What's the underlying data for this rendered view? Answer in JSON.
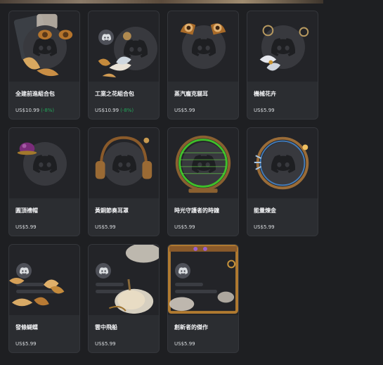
{
  "colors": {
    "background": "#1e1f22",
    "card": "#2b2d31",
    "discount": "#23a55a"
  },
  "items": [
    {
      "name": "全建前進組合包",
      "price": "US$10.99",
      "discount": "(-8%)"
    },
    {
      "name": "工業之花組合包",
      "price": "US$10.99",
      "discount": "(-8%)"
    },
    {
      "name": "蒸汽龐克貓耳",
      "price": "US$5.99",
      "discount": ""
    },
    {
      "name": "機械花卉",
      "price": "US$5.99",
      "discount": ""
    },
    {
      "name": "圓頂禮帽",
      "price": "US$5.99",
      "discount": ""
    },
    {
      "name": "黃銅節奏耳罩",
      "price": "US$5.99",
      "discount": ""
    },
    {
      "name": "時光守護者的時鐘",
      "price": "US$5.99",
      "discount": ""
    },
    {
      "name": "能量煉金",
      "price": "US$5.99",
      "discount": ""
    },
    {
      "name": "發條蝴蝶",
      "price": "US$5.99",
      "discount": ""
    },
    {
      "name": "雲中飛船",
      "price": "US$5.99",
      "discount": ""
    },
    {
      "name": "創新者的傑作",
      "price": "US$5.99",
      "discount": ""
    }
  ]
}
